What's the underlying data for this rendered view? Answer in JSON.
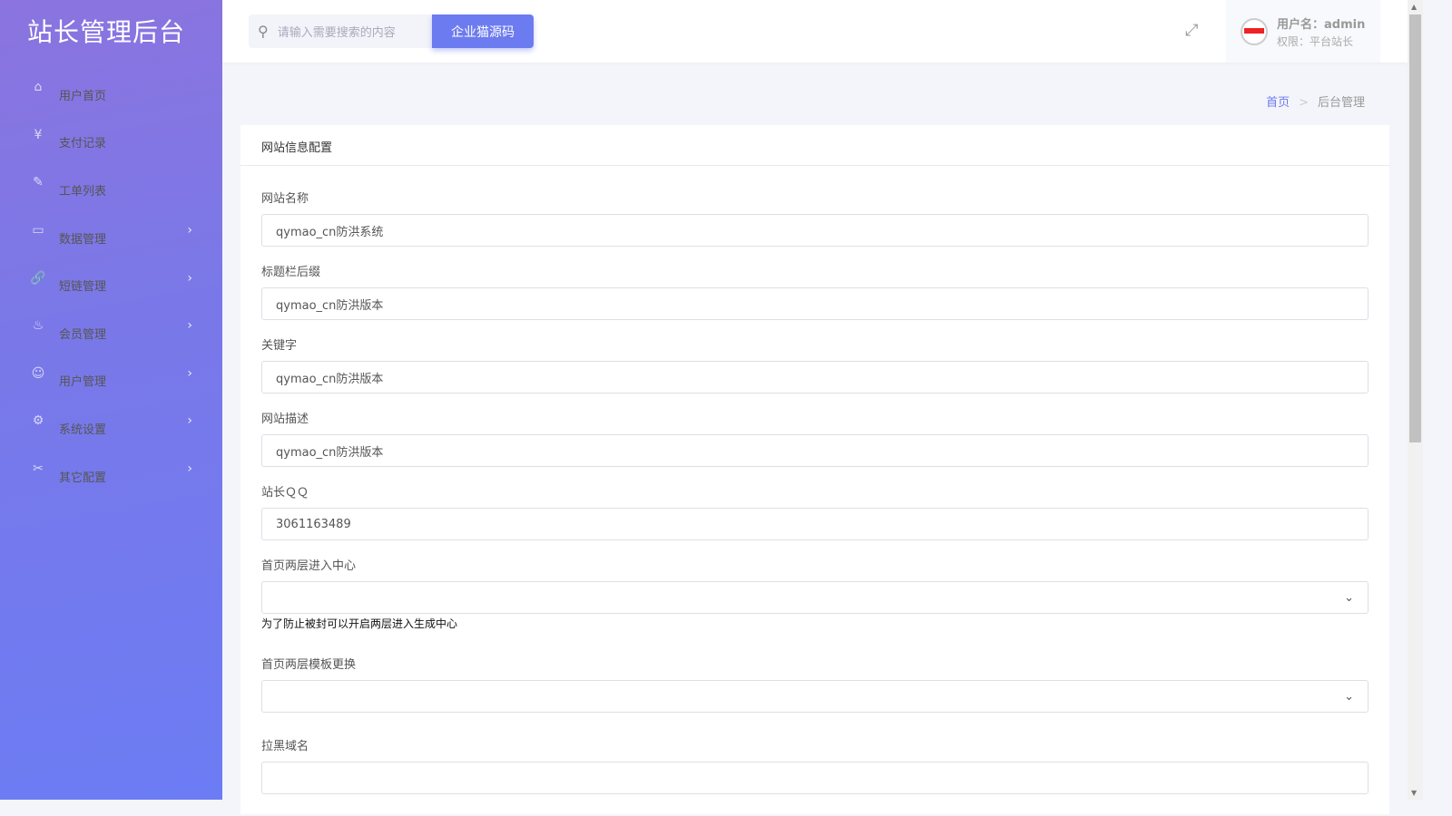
{
  "sidebar": {
    "title": "站长管理后台",
    "items": [
      {
        "label": "用户首页",
        "icon": "⌂",
        "sub": false
      },
      {
        "label": "支付记录",
        "icon": "¥",
        "sub": false
      },
      {
        "label": "工单列表",
        "icon": "✎",
        "sub": false
      },
      {
        "label": "数据管理",
        "icon": "▭",
        "sub": true
      },
      {
        "label": "短链管理",
        "icon": "🔗",
        "sub": true
      },
      {
        "label": "会员管理",
        "icon": "♨",
        "sub": true
      },
      {
        "label": "用户管理",
        "icon": "☺",
        "sub": true
      },
      {
        "label": "系统设置",
        "icon": "⚙",
        "sub": true
      },
      {
        "label": "其它配置",
        "icon": "✂",
        "sub": true
      }
    ]
  },
  "topbar": {
    "search_placeholder": "请输入需要搜索的内容",
    "brand_button": "企业猫源码",
    "username": "用户名：admin",
    "role": "权限：平台站长"
  },
  "breadcrumb": {
    "home": "首页",
    "sep": ">",
    "current": "后台管理"
  },
  "card": {
    "title": "网站信息配置",
    "fields": [
      {
        "label": "网站名称",
        "value": "qymao_cn防洪系统"
      },
      {
        "label": "标题栏后缀",
        "value": "qymao_cn防洪版本"
      },
      {
        "label": "关键字",
        "value": "qymao_cn防洪版本"
      },
      {
        "label": "网站描述",
        "value": "qymao_cn防洪版本"
      },
      {
        "label": "站长ＱＱ",
        "value": "3061163489"
      }
    ],
    "select1": {
      "label": "首页两层进入中心",
      "value": "",
      "hint": "为了防止被封可以开启两层进入生成中心"
    },
    "select2": {
      "label": "首页两层模板更换",
      "value": ""
    },
    "field_last": {
      "label": "拉黑域名"
    }
  }
}
